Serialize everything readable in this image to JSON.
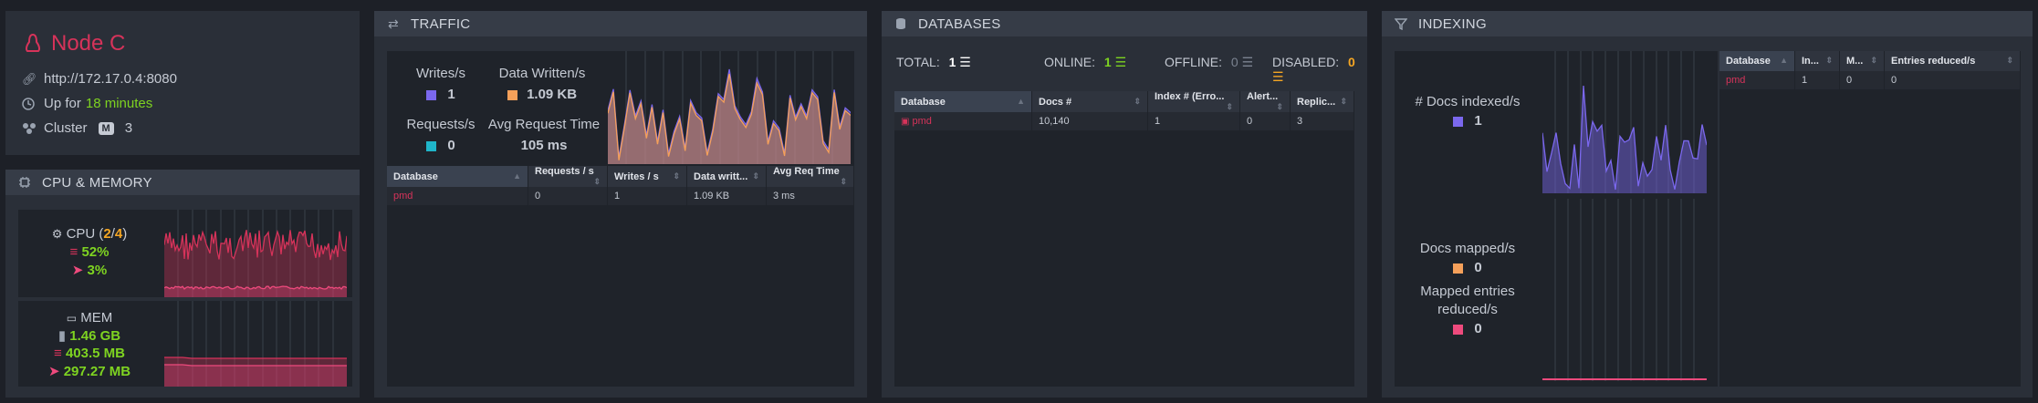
{
  "node": {
    "name": "Node C",
    "url": "http://172.17.0.4:8080",
    "uptime_prefix": "Up for",
    "uptime_value": "18 minutes",
    "cluster_label": "Cluster",
    "cluster_badge": "M",
    "cluster_count": "3"
  },
  "cpu_memory": {
    "title": "CPU & MEMORY",
    "cpu_label": "CPU",
    "cpu_used": "2",
    "cpu_sep": "/",
    "cpu_total": "4",
    "cpu_machine": "52%",
    "cpu_process": "3%",
    "mem_label": "MEM",
    "mem_total": "1.46 GB",
    "mem_machine": "403.5 MB",
    "mem_process": "297.27 MB"
  },
  "traffic": {
    "title": "TRAFFIC",
    "writes_label": "Writes/s",
    "writes_value": "1",
    "data_written_label": "Data Written/s",
    "data_written_value": "1.09 KB",
    "requests_label": "Requests/s",
    "requests_value": "0",
    "avg_request_label": "Avg Request Time",
    "avg_request_value": "105 ms",
    "columns": [
      "Database",
      "Requests / s",
      "Writes / s",
      "Data writt...",
      "Avg Req Time"
    ],
    "rows": [
      [
        "pmd",
        "0",
        "1",
        "1.09 KB",
        "3 ms"
      ]
    ]
  },
  "databases": {
    "title": "DATABASES",
    "total_label": "TOTAL:",
    "total_value": "1",
    "online_label": "ONLINE:",
    "online_value": "1",
    "offline_label": "OFFLINE:",
    "offline_value": "0",
    "disabled_label": "DISABLED:",
    "disabled_value": "0",
    "columns": [
      "Database",
      "Docs #",
      "Index # (Erro...",
      "Alert...",
      "Replic..."
    ],
    "rows": [
      [
        "pmd",
        "10,140",
        "1",
        "0",
        "3"
      ]
    ]
  },
  "indexing": {
    "title": "INDEXING",
    "docs_indexed_label": "# Docs indexed/s",
    "docs_indexed_value": "1",
    "docs_mapped_label": "Docs mapped/s",
    "docs_mapped_value": "0",
    "mapped_reduced_label": "Mapped entries reduced/s",
    "mapped_reduced_value": "0",
    "columns": [
      "Database",
      "In...",
      "M...",
      "Entries reduced/s"
    ],
    "rows": [
      [
        "pmd",
        "1",
        "0",
        "0"
      ]
    ]
  },
  "colors": {
    "brand_red": "#d6335a",
    "green": "#7ed321",
    "orange": "#f5a623",
    "purple": "#7b68ee",
    "cyan": "#1fb5c9",
    "pink": "#ee4a7d"
  }
}
